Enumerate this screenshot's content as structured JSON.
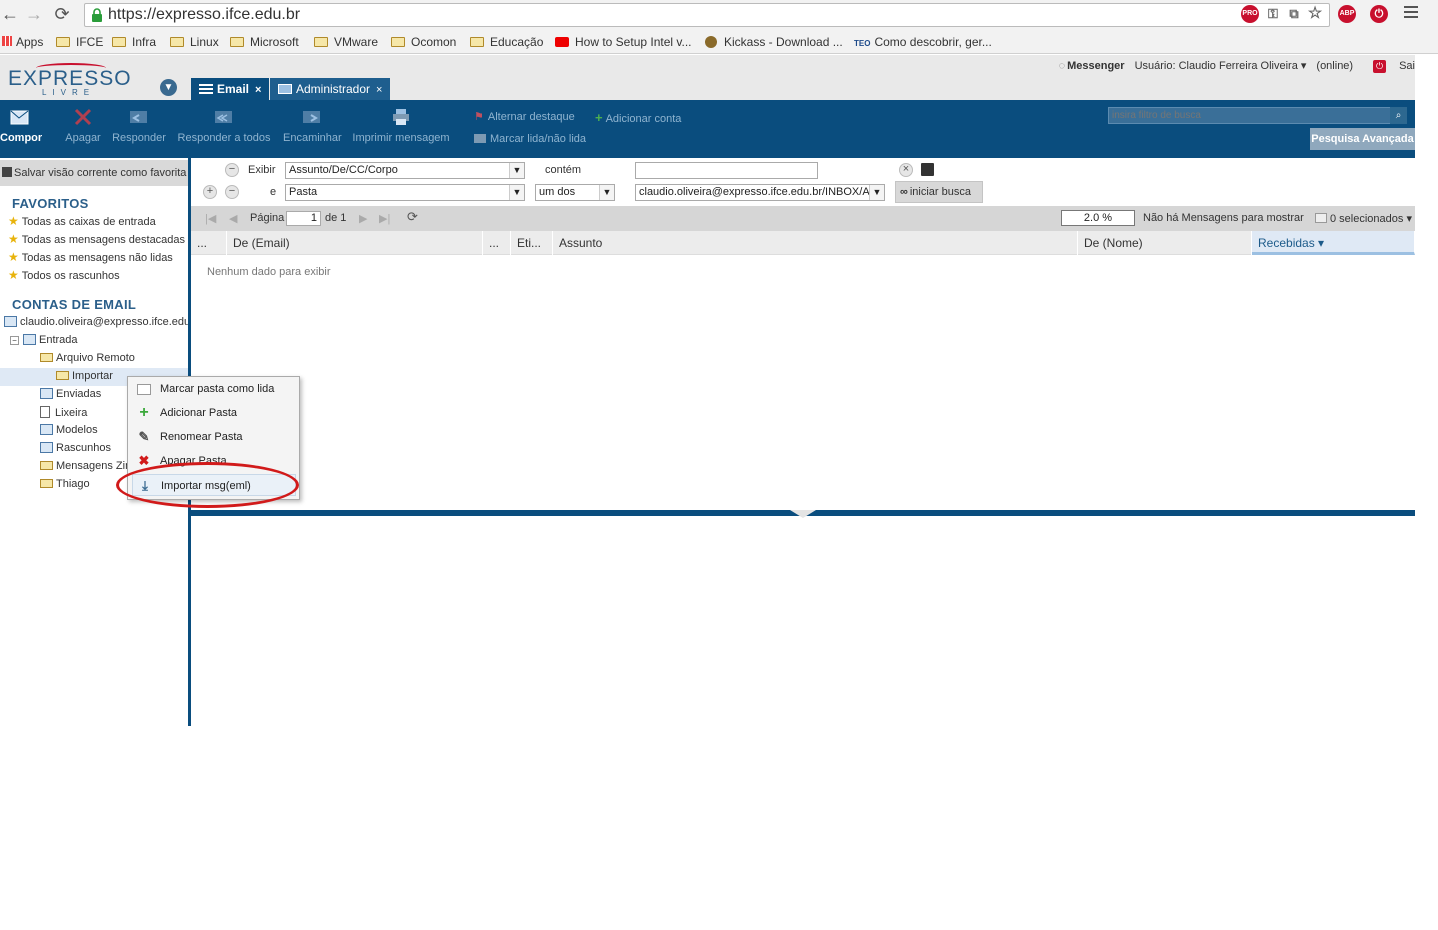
{
  "browser": {
    "url": "https://expresso.ifce.edu.br",
    "bookmarks": [
      "Apps",
      "IFCE",
      "Infra",
      "Linux",
      "Microsoft",
      "VMware",
      "Ocomon",
      "Educação",
      "How to Setup Intel v...",
      "Kickass - Download ...",
      "Como descobrir, ger..."
    ],
    "ext_pro": "PRO",
    "ext_abp": "ABP"
  },
  "header": {
    "logo_main": "EXPRESSO",
    "logo_sub": "LIVRE",
    "tabs": [
      {
        "label": "Email",
        "close": "×"
      },
      {
        "label": "Administrador",
        "close": "×"
      }
    ],
    "messenger": "Messenger",
    "user": "Usuário: Claudio Ferreira Oliveira ▾",
    "status": "(online)",
    "exit": "Sai"
  },
  "toolbar": {
    "compose": "Compor",
    "delete": "Apagar",
    "reply": "Responder",
    "reply_all": "Responder a todos",
    "forward": "Encaminhar",
    "print": "Imprimir mensagem",
    "toggle_flag": "Alternar destaque",
    "add_account": "Adicionar conta",
    "mark_read": "Marcar lida/não lida",
    "search_placeholder": "insira filtro de busca",
    "advanced_search": "Pesquisa Avançada"
  },
  "sidebar": {
    "save_view": "Salvar visão corrente como favorita",
    "favorites_title": "FAVORITOS",
    "favorites": [
      "Todas as caixas de entrada",
      "Todas as mensagens destacadas",
      "Todas as mensagens não lidas",
      "Todos os rascunhos"
    ],
    "accounts_title": "CONTAS DE EMAIL",
    "account": "claudio.oliveira@expresso.ifce.edu.br",
    "inbox": "Entrada",
    "folders": {
      "remote": "Arquivo Remoto",
      "import": "Importar",
      "sent": "Enviadas",
      "trash": "Lixeira",
      "templates": "Modelos",
      "drafts": "Rascunhos",
      "zimbra": "Mensagens Zimbra",
      "thiago": "Thiago"
    }
  },
  "filter": {
    "show_label": "Exibir",
    "and_label": "e",
    "field1": "Assunto/De/CC/Corpo",
    "op1": "contém",
    "value1": "",
    "field2": "Pasta",
    "op2": "um dos",
    "value2": "claudio.oliveira@expresso.ifce.edu.br/INBOX/Arquivo Remoto/Importar",
    "start_search": "iniciar busca"
  },
  "pager": {
    "page_label": "Página",
    "page": "1",
    "of_label": "de 1",
    "zoom": "2.0 %",
    "no_messages": "Não há Mensagens para mostrar",
    "selected": "0 selecionados ▾"
  },
  "grid": {
    "columns": [
      "...",
      "De (Email)",
      "...",
      "Eti...",
      "Assunto",
      "De (Nome)",
      "Recebidas ▾"
    ],
    "empty": "Nenhum dado para exibir"
  },
  "context_menu": {
    "items": [
      "Marcar pasta como lida",
      "Adicionar Pasta",
      "Renomear Pasta",
      "Apagar Pasta",
      "Importar msg(eml)"
    ]
  },
  "colors": {
    "brand_blue": "#0a4d7e",
    "highlight_red": "#d11a1a"
  }
}
